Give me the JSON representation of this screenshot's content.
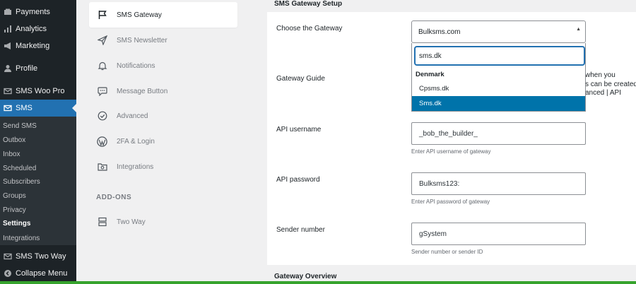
{
  "wp_menu": {
    "items": [
      {
        "label": "Payments",
        "icon": "payments-icon"
      },
      {
        "label": "Analytics",
        "icon": "analytics-icon"
      },
      {
        "label": "Marketing",
        "icon": "marketing-icon"
      },
      {
        "label": "Profile",
        "icon": "profile-icon"
      },
      {
        "label": "SMS Woo Pro",
        "icon": "sms-icon"
      },
      {
        "label": "SMS",
        "icon": "sms-icon"
      },
      {
        "label": "SMS Two Way",
        "icon": "sms-icon"
      },
      {
        "label": "Collapse Menu",
        "icon": "collapse-icon"
      }
    ],
    "submenu": [
      "Send SMS",
      "Outbox",
      "Inbox",
      "Scheduled",
      "Subscribers",
      "Groups",
      "Privacy",
      "Settings",
      "Integrations"
    ],
    "active_submenu": "Settings",
    "colors": {
      "bg": "#1d2327",
      "current": "#2271b1"
    }
  },
  "settings_nav": {
    "items": [
      {
        "label": "SMS Gateway",
        "icon": "flag-icon"
      },
      {
        "label": "SMS Newsletter",
        "icon": "send-icon"
      },
      {
        "label": "Notifications",
        "icon": "bell-icon"
      },
      {
        "label": "Message Button",
        "icon": "chat-icon"
      },
      {
        "label": "Advanced",
        "icon": "check-circle-icon"
      },
      {
        "label": "2FA & Login",
        "icon": "wordpress-icon"
      },
      {
        "label": "Integrations",
        "icon": "folder-gear-icon"
      }
    ],
    "addons_heading": "ADD-ONS",
    "addons": [
      {
        "label": "Two Way",
        "icon": "columns-icon"
      }
    ]
  },
  "main": {
    "section_title": "SMS Gateway Setup",
    "gateway": {
      "label": "Choose the Gateway",
      "selected": "Bulksms.com",
      "search_value": "sms.dk",
      "group": "Denmark",
      "options": [
        "Cpsms.dk",
        "Sms.dk"
      ],
      "highlighted": "Sms.dk"
    },
    "guide": {
      "label": "Gateway Guide",
      "text_lines": [
        "when you",
        "s can be created",
        "anced | API"
      ]
    },
    "username": {
      "label": "API username",
      "value": "_bob_the_builder_",
      "description": "Enter API username of gateway"
    },
    "password": {
      "label": "API password",
      "value": "Bulksms123:",
      "description": "Enter API password of gateway"
    },
    "sender": {
      "label": "Sender number",
      "value": "gSystem",
      "description": "Sender number or sender ID"
    },
    "overview_title": "Gateway Overview"
  }
}
